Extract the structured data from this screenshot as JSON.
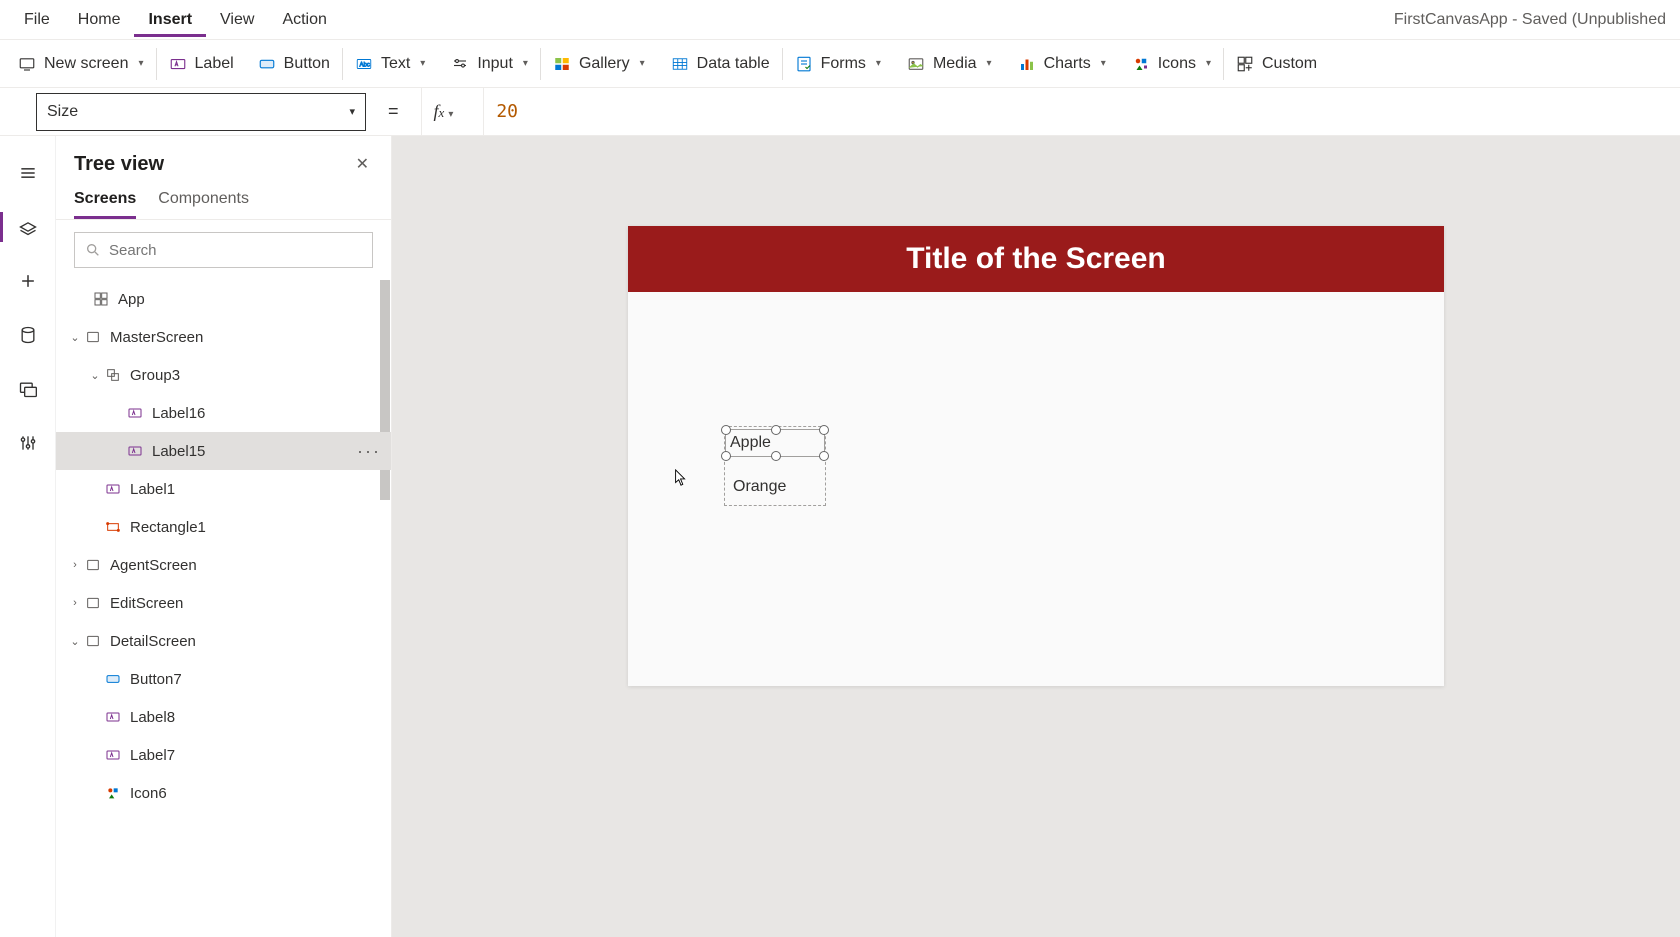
{
  "menubar": {
    "items": [
      "File",
      "Home",
      "Insert",
      "View",
      "Action"
    ],
    "active_index": 2,
    "app_title": "FirstCanvasApp - Saved (Unpublished"
  },
  "ribbon": {
    "new_screen": "New screen",
    "label": "Label",
    "button": "Button",
    "text": "Text",
    "input": "Input",
    "gallery": "Gallery",
    "data_table": "Data table",
    "forms": "Forms",
    "media": "Media",
    "charts": "Charts",
    "icons": "Icons",
    "custom": "Custom"
  },
  "formula": {
    "property": "Size",
    "value": "20"
  },
  "treepanel": {
    "title": "Tree view",
    "tabs": [
      "Screens",
      "Components"
    ],
    "active_tab": 0,
    "search_placeholder": "Search",
    "app_label": "App",
    "nodes": {
      "masterScreen": "MasterScreen",
      "group3": "Group3",
      "label16": "Label16",
      "label15": "Label15",
      "label1": "Label1",
      "rectangle1": "Rectangle1",
      "agentScreen": "AgentScreen",
      "editScreen": "EditScreen",
      "detailScreen": "DetailScreen",
      "button7": "Button7",
      "label8": "Label8",
      "label7": "Label7",
      "icon6": "Icon6"
    }
  },
  "canvas": {
    "title": "Title of the Screen",
    "label_apple": "Apple",
    "label_orange": "Orange"
  }
}
